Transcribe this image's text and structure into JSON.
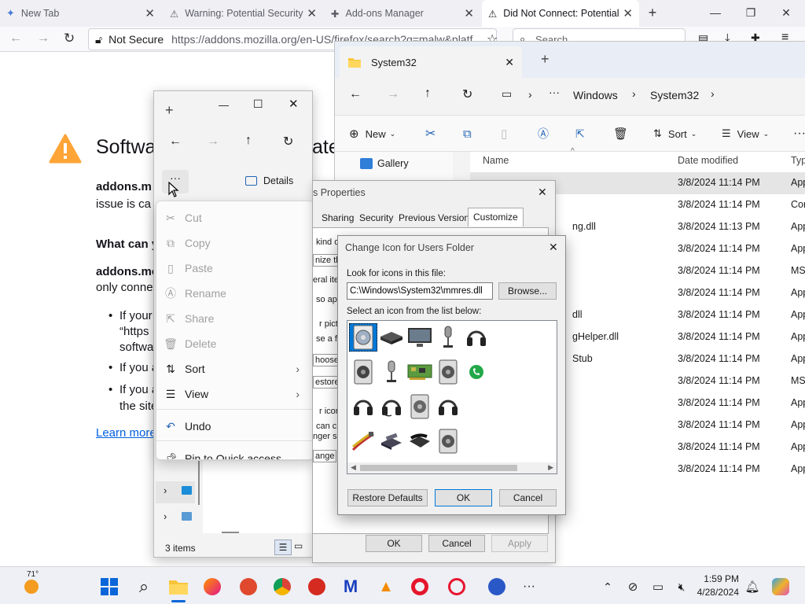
{
  "browser": {
    "tabs": [
      {
        "label": "New Tab"
      },
      {
        "label": "Warning: Potential Security"
      },
      {
        "label": "Add-ons Manager"
      },
      {
        "label": "Did Not Connect: Potential"
      }
    ],
    "not_secure": "Not Secure",
    "url": "https://addons.mozilla.org/en-US/firefox/search?q=malw&platf",
    "search_placeholder": "Search"
  },
  "page": {
    "heading": "Softwa",
    "heading_tail": "ate",
    "p1_bold": "addons.m",
    "p1_rest": "issue is ca",
    "h2": "What can y",
    "p2_bold": "addons.mo",
    "p2_rest": "only conne",
    "bullet1_a": "If your",
    "bullet1_b": "“https",
    "bullet1_c": "softwa",
    "bullet2": "If you a",
    "bullet3_a": "If you a",
    "bullet3_b": "the site",
    "learn_more": "Learn more"
  },
  "explorer_main": {
    "tab_title": "System32",
    "breadcrumb": [
      "Windows",
      "System32"
    ],
    "commands": {
      "new": "New",
      "sort": "Sort",
      "view": "View"
    },
    "sidebar_gallery": "Gallery",
    "columns": {
      "name": "Name",
      "date": "Date modified",
      "type": "Typ"
    },
    "rows": [
      {
        "name": "",
        "date": "3/8/2024 11:14 PM",
        "type": "App"
      },
      {
        "name": "",
        "date": "3/8/2024 11:14 PM",
        "type": "Cor"
      },
      {
        "name": "ng.dll",
        "date": "3/8/2024 11:13 PM",
        "type": "App"
      },
      {
        "name": "",
        "date": "3/8/2024 11:14 PM",
        "type": "App"
      },
      {
        "name": "",
        "date": "3/8/2024 11:14 PM",
        "type": "MS"
      },
      {
        "name": "",
        "date": "3/8/2024 11:14 PM",
        "type": "App"
      },
      {
        "name": "dll",
        "date": "3/8/2024 11:14 PM",
        "type": "App"
      },
      {
        "name": "gHelper.dll",
        "date": "3/8/2024 11:14 PM",
        "type": "App"
      },
      {
        "name": "Stub",
        "date": "3/8/2024 11:14 PM",
        "type": "App"
      },
      {
        "name": "",
        "date": "3/8/2024 11:14 PM",
        "type": "MS"
      },
      {
        "name": "",
        "date": "3/8/2024 11:14 PM",
        "type": "App"
      },
      {
        "name": "",
        "date": "3/8/2024 11:14 PM",
        "type": "App"
      },
      {
        "name": "",
        "date": "3/8/2024 11:14 PM",
        "type": "App"
      },
      {
        "name": "",
        "date": "3/8/2024 11:14 PM",
        "type": "App"
      }
    ]
  },
  "explorer_small": {
    "details_label": "Details",
    "status_items": "3 items"
  },
  "context_menu": {
    "items": [
      {
        "label": "Cut"
      },
      {
        "label": "Copy"
      },
      {
        "label": "Paste"
      },
      {
        "label": "Rename"
      },
      {
        "label": "Share"
      },
      {
        "label": "Delete"
      },
      {
        "label": "Sort"
      },
      {
        "label": "View"
      },
      {
        "label": "Undo"
      },
      {
        "label": "Pin to Quick access"
      }
    ]
  },
  "properties_dialog": {
    "title": "s Properties",
    "tabs": [
      "Sharing",
      "Security",
      "Previous Versions",
      "Customize"
    ],
    "fragments": [
      "kind o",
      "nize thi",
      "eral ite",
      "so app",
      "r pictur",
      "se a fil",
      "hoose",
      "estore",
      "r icons",
      "can ch",
      "nger sh",
      "ange"
    ],
    "ok": "OK",
    "cancel": "Cancel",
    "apply": "Apply"
  },
  "change_icon_dialog": {
    "title": "Change Icon for Users Folder",
    "look_label": "Look for icons in this file:",
    "file_path": "C:\\Windows\\System32\\mmres.dll",
    "browse": "Browse...",
    "select_label": "Select an icon from the list below:",
    "restore": "Restore Defaults",
    "ok": "OK",
    "cancel": "Cancel"
  },
  "taskbar": {
    "weather_temp": "71°",
    "time": "1:59 PM",
    "date": "4/28/2024"
  }
}
